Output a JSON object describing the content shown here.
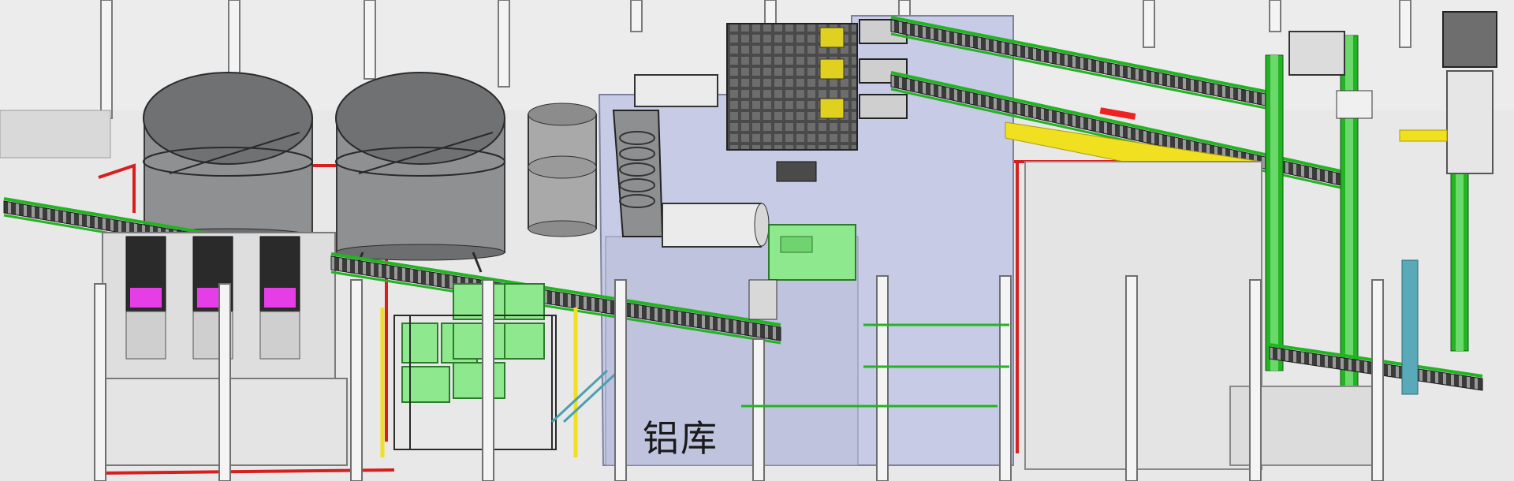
{
  "plant": {
    "area_label": "铝库",
    "colors": {
      "floor": "#e6e6e6",
      "bay": "#c9cce6",
      "tank_top": "#6f7072",
      "tank_body": "#8a8b8d",
      "conveyor_green": "#22b422",
      "conveyor_dark": "#2a2a2a",
      "machine_green": "#8ee88e",
      "hopper_magenta": "#e63ee6",
      "walkway_yellow": "#f0e020",
      "pipe_red": "#d81e1e",
      "column": "#f2f2f2"
    }
  }
}
